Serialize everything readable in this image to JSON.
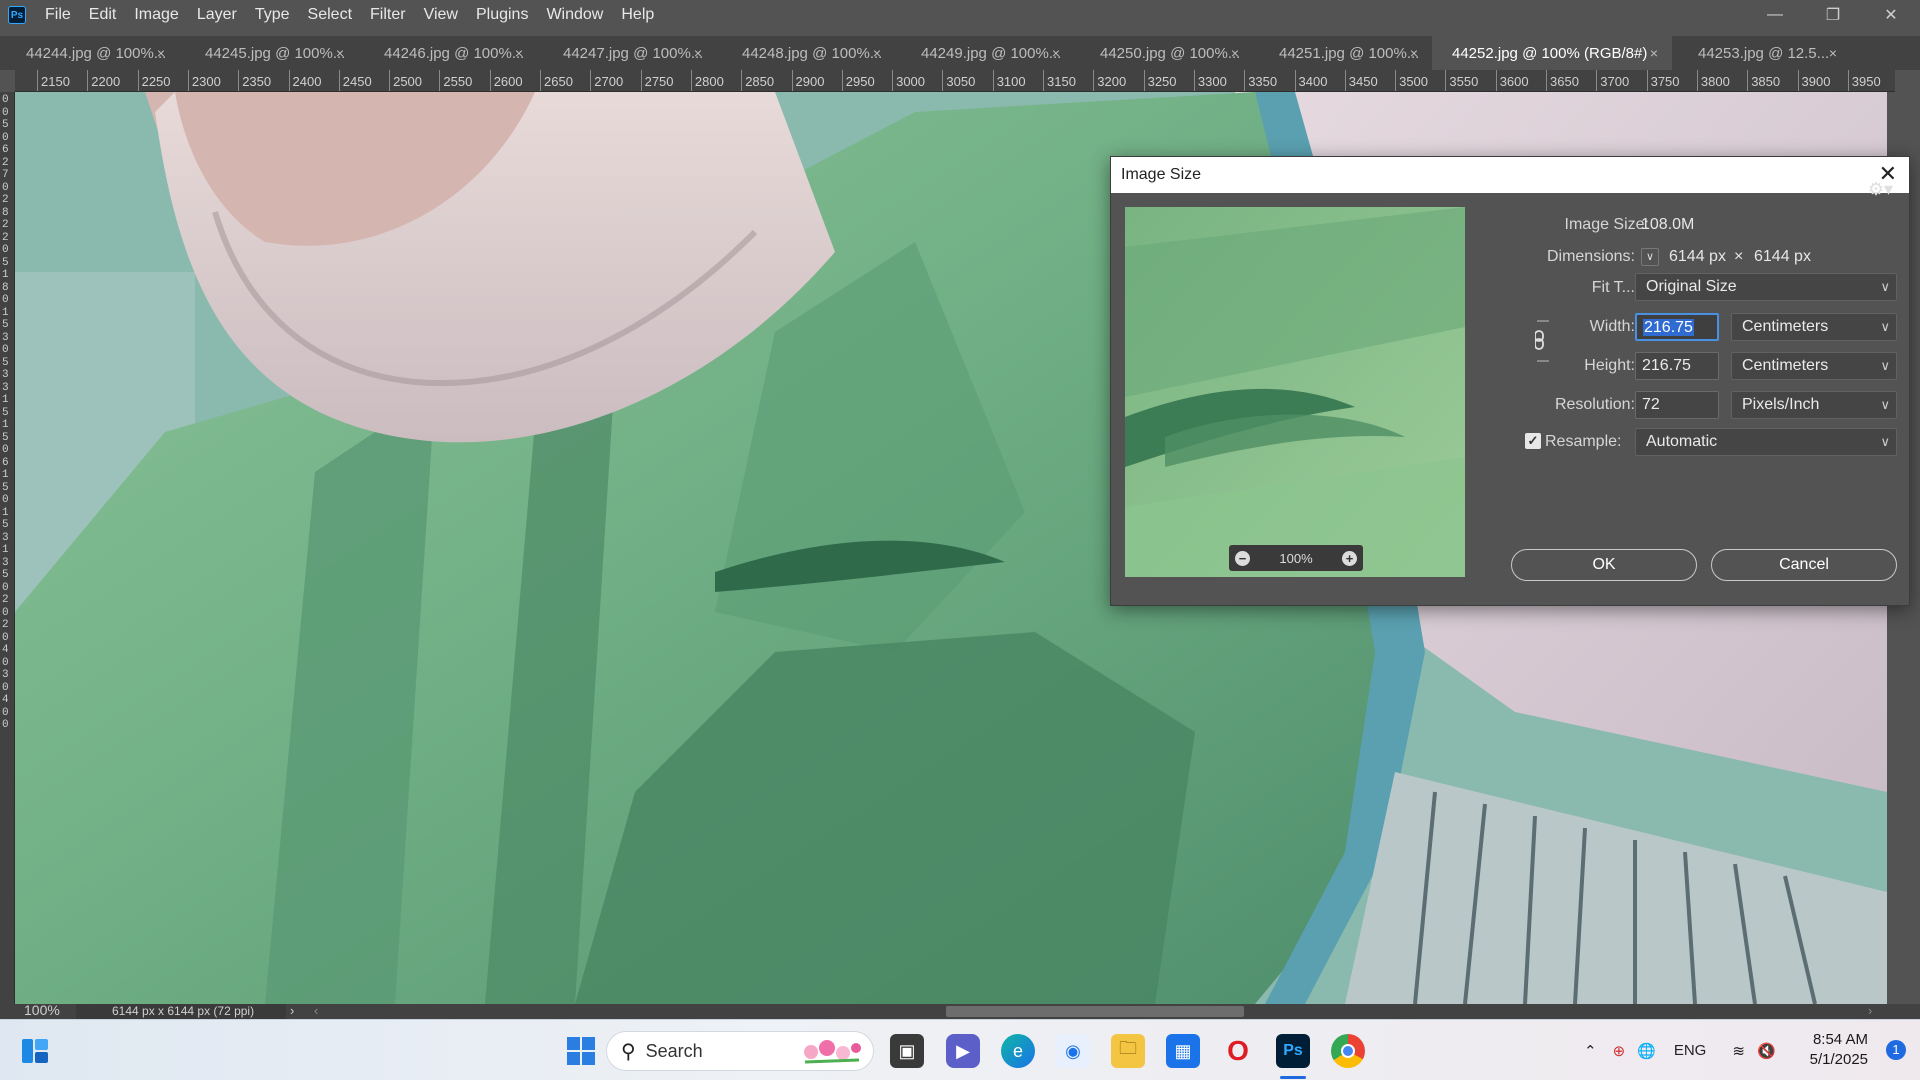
{
  "app": {
    "logo": "Ps",
    "menu": [
      "File",
      "Edit",
      "Image",
      "Layer",
      "Type",
      "Select",
      "Filter",
      "View",
      "Plugins",
      "Window",
      "Help"
    ]
  },
  "tabs": [
    {
      "label": "44244.jpg @ 100%...",
      "close": "×"
    },
    {
      "label": "44245.jpg @ 100%...",
      "close": "×"
    },
    {
      "label": "44246.jpg @ 100%...",
      "close": "×"
    },
    {
      "label": "44247.jpg @ 100%...",
      "close": "×"
    },
    {
      "label": "44248.jpg @ 100%...",
      "close": "×"
    },
    {
      "label": "44249.jpg @ 100%...",
      "close": "×"
    },
    {
      "label": "44250.jpg @ 100%...",
      "close": "×"
    },
    {
      "label": "44251.jpg @ 100%...",
      "close": "×"
    },
    {
      "label": "44252.jpg @ 100% (RGB/8#)",
      "close": "×"
    },
    {
      "label": "44253.jpg @ 12.5...",
      "close": "×"
    }
  ],
  "ruler": {
    "ticks": [
      "2150",
      "2200",
      "2250",
      "2300",
      "2350",
      "2400",
      "2450",
      "2500",
      "2550",
      "2600",
      "2650",
      "2700",
      "2750",
      "2800",
      "2850",
      "2900",
      "2950",
      "3000",
      "3050",
      "3100",
      "3150",
      "3200",
      "3250",
      "3300",
      "3350",
      "3400",
      "3450",
      "3500",
      "3550",
      "3600",
      "3650",
      "3700",
      "3750",
      "3800",
      "3850",
      "3900",
      "3950"
    ],
    "vertical_digits": "005062702822051801530533151506150153135020204030400"
  },
  "status": {
    "zoom": "100%",
    "doc_info": "6144 px x 6144 px (72 ppi)",
    "arrow": "›",
    "scroll_left": "‹",
    "scroll_right": "›"
  },
  "dialog": {
    "title": "Image Size",
    "close": "✕",
    "image_size_label": "Image Size:",
    "image_size_value": "108.0M",
    "dimensions_label": "Dimensions:",
    "dimensions_width": "6144 px",
    "dimensions_times": "×",
    "dimensions_height": "6144 px",
    "fit_label": "Fit T...",
    "fit_value": "Original Size",
    "width_label": "Width:",
    "width_value": "216.75",
    "width_unit": "Centimeters",
    "height_label": "Height:",
    "height_value": "216.75",
    "height_unit": "Centimeters",
    "resolution_label": "Resolution:",
    "resolution_value": "72",
    "resolution_unit": "Pixels/Inch",
    "resample_label": "Resample:",
    "resample_checked": true,
    "resample_value": "Automatic",
    "preview_zoom": "100%",
    "ok_label": "OK",
    "cancel_label": "Cancel"
  },
  "taskbar": {
    "search_placeholder": "Search",
    "language": "ENG",
    "time": "8:54 AM",
    "date": "5/1/2025",
    "notifications": "1"
  },
  "colors": {
    "ps_panel": "#535353",
    "ps_dark": "#424242",
    "focus_blue": "#4a90e2",
    "canvas_green": "#7fb98a"
  }
}
